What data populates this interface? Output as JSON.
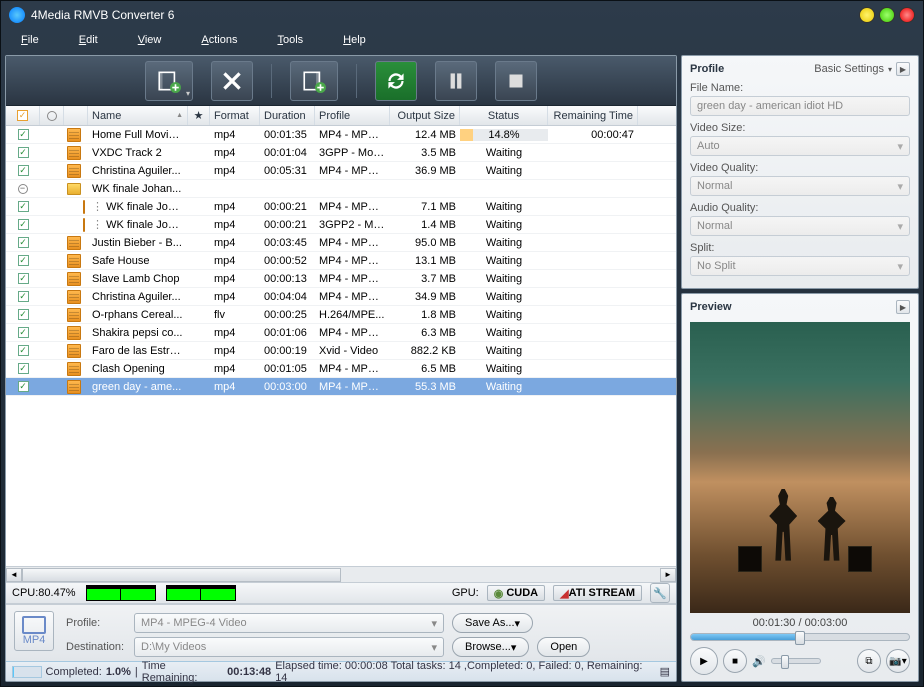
{
  "window": {
    "title": "4Media RMVB Converter 6"
  },
  "menu": {
    "file": "File",
    "edit": "Edit",
    "view": "View",
    "actions": "Actions",
    "tools": "Tools",
    "help": "Help"
  },
  "columns": {
    "name": "Name",
    "format": "Format",
    "duration": "Duration",
    "profile": "Profile",
    "output": "Output Size",
    "status": "Status",
    "remaining": "Remaining Time"
  },
  "rows": [
    {
      "chk": true,
      "indent": 0,
      "name": "Home Full Movie ...",
      "fmt": "mp4",
      "dur": "00:01:35",
      "prof": "MP4 - MPEG...",
      "out": "12.4 MB",
      "stat": "14.8%",
      "rem": "00:00:47",
      "running": true
    },
    {
      "chk": true,
      "indent": 0,
      "name": "VXDC Track 2",
      "fmt": "mp4",
      "dur": "00:01:04",
      "prof": "3GPP - Mobil...",
      "out": "3.5 MB",
      "stat": "Waiting",
      "rem": ""
    },
    {
      "chk": true,
      "indent": 0,
      "name": "Christina Aguiler...",
      "fmt": "mp4",
      "dur": "00:05:31",
      "prof": "MP4 - MPEG...",
      "out": "36.9 MB",
      "stat": "Waiting",
      "rem": ""
    },
    {
      "chk": false,
      "indent": 0,
      "folder": true,
      "expand": "-",
      "name": "WK finale Johan...",
      "fmt": "",
      "dur": "",
      "prof": "",
      "out": "",
      "stat": "",
      "rem": ""
    },
    {
      "chk": true,
      "indent": 1,
      "name": "WK finale Johan...",
      "fmt": "mp4",
      "dur": "00:00:21",
      "prof": "MP4 - MPEG...",
      "out": "7.1 MB",
      "stat": "Waiting",
      "rem": ""
    },
    {
      "chk": true,
      "indent": 1,
      "name": "WK finale Johan...",
      "fmt": "mp4",
      "dur": "00:00:21",
      "prof": "3GPP2 - Mo...",
      "out": "1.4 MB",
      "stat": "Waiting",
      "rem": ""
    },
    {
      "chk": true,
      "indent": 0,
      "name": "Justin Bieber - B...",
      "fmt": "mp4",
      "dur": "00:03:45",
      "prof": "MP4 - MPEG...",
      "out": "95.0 MB",
      "stat": "Waiting",
      "rem": ""
    },
    {
      "chk": true,
      "indent": 0,
      "name": "Safe House",
      "fmt": "mp4",
      "dur": "00:00:52",
      "prof": "MP4 - MPEG...",
      "out": "13.1 MB",
      "stat": "Waiting",
      "rem": ""
    },
    {
      "chk": true,
      "indent": 0,
      "name": "Slave Lamb Chop",
      "fmt": "mp4",
      "dur": "00:00:13",
      "prof": "MP4 - MPEG...",
      "out": "3.7 MB",
      "stat": "Waiting",
      "rem": ""
    },
    {
      "chk": true,
      "indent": 0,
      "name": "Christina Aguiler...",
      "fmt": "mp4",
      "dur": "00:04:04",
      "prof": "MP4 - MPEG...",
      "out": "34.9 MB",
      "stat": "Waiting",
      "rem": ""
    },
    {
      "chk": true,
      "indent": 0,
      "name": "O-rphans Cereal...",
      "fmt": "flv",
      "dur": "00:00:25",
      "prof": "H.264/MPE...",
      "out": "1.8 MB",
      "stat": "Waiting",
      "rem": ""
    },
    {
      "chk": true,
      "indent": 0,
      "name": "Shakira pepsi co...",
      "fmt": "mp4",
      "dur": "00:01:06",
      "prof": "MP4 - MPEG...",
      "out": "6.3 MB",
      "stat": "Waiting",
      "rem": ""
    },
    {
      "chk": true,
      "indent": 0,
      "name": "Faro de las Estre...",
      "fmt": "mp4",
      "dur": "00:00:19",
      "prof": "Xvid - Video",
      "out": "882.2 KB",
      "stat": "Waiting",
      "rem": ""
    },
    {
      "chk": true,
      "indent": 0,
      "name": "Clash Opening",
      "fmt": "mp4",
      "dur": "00:01:05",
      "prof": "MP4 - MPEG...",
      "out": "6.5 MB",
      "stat": "Waiting",
      "rem": ""
    },
    {
      "chk": true,
      "indent": 0,
      "selected": true,
      "name": "green day - ame...",
      "fmt": "mp4",
      "dur": "00:03:00",
      "prof": "MP4 - MPEG...",
      "out": "55.3 MB",
      "stat": "Waiting",
      "rem": ""
    }
  ],
  "cpu": {
    "label": "CPU:80.47%",
    "gpu_label": "GPU:",
    "cuda": "CUDA",
    "ati": "ATI STREAM"
  },
  "bottom": {
    "profile_label": "Profile:",
    "profile_value": "MP4 - MPEG-4 Video",
    "dest_label": "Destination:",
    "dest_value": "D:\\My Videos",
    "saveas": "Save As...",
    "browse": "Browse...",
    "open": "Open"
  },
  "status": {
    "completed_label": "Completed:",
    "completed_pct": "1.0%",
    "time_rem_label": "Time Remaining:",
    "time_rem": "00:13:48",
    "elapsed": "Elapsed time: 00:00:08 Total tasks: 14 ,Completed: 0, Failed: 0, Remaining: 14"
  },
  "profile_panel": {
    "title": "Profile",
    "basic": "Basic Settings",
    "filename_label": "File Name:",
    "filename": "green day - american idiot HD",
    "videosize_label": "Video Size:",
    "videosize": "Auto",
    "vquality_label": "Video Quality:",
    "vquality": "Normal",
    "aquality_label": "Audio Quality:",
    "aquality": "Normal",
    "split_label": "Split:",
    "split": "No Split"
  },
  "preview": {
    "title": "Preview",
    "time": "00:01:30 / 00:03:00"
  }
}
